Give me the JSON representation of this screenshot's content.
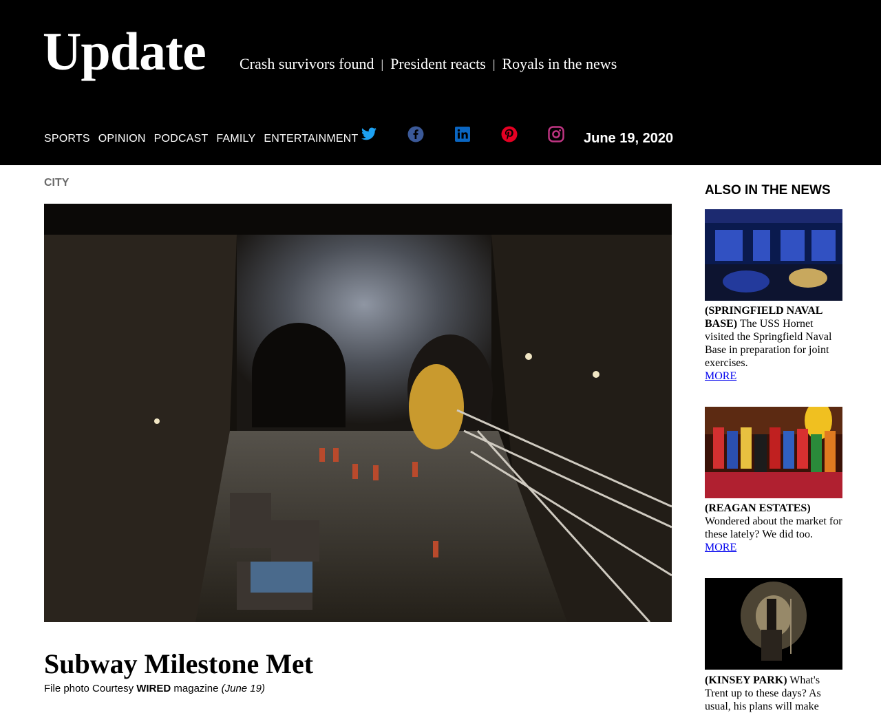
{
  "brand": "Update",
  "headlines": [
    "Crash survivors found",
    "President reacts",
    "Royals in the news"
  ],
  "headline_separator": "|",
  "nav": [
    "SPORTS",
    "OPINION",
    "PODCAST",
    "FAMILY",
    "ENTERTAINMENT"
  ],
  "social": [
    {
      "name": "twitter-icon",
      "color": "#1DA1F2"
    },
    {
      "name": "facebook-icon",
      "color": "#3b5998"
    },
    {
      "name": "linkedin-icon",
      "color": "#0A66C2"
    },
    {
      "name": "pinterest-icon",
      "color": "#E60023"
    },
    {
      "name": "instagram-icon",
      "color": "#C13584"
    }
  ],
  "date": "June 19, 2020",
  "article": {
    "section": "CITY",
    "title": "Subway Milestone Met",
    "credit_prefix": "File photo Courtesy ",
    "credit_source": "WIRED",
    "credit_middle": " magazine ",
    "credit_date": "(June 19)"
  },
  "sidebar": {
    "heading": "ALSO IN THE NEWS",
    "cards": [
      {
        "place": "(SPRINGFIELD NAVAL BASE)",
        "text": "The USS Hornet visited the Springfield Naval Base in preparation for joint exercises.",
        "more": "MORE"
      },
      {
        "place": "(REAGAN ESTATES)",
        "text": "Wondered about the market for these lately? We did too.",
        "more": "MORE"
      },
      {
        "place": "(KINSEY PARK)",
        "text": "What's Trent up to these days? As usual, his plans will make"
      }
    ]
  }
}
